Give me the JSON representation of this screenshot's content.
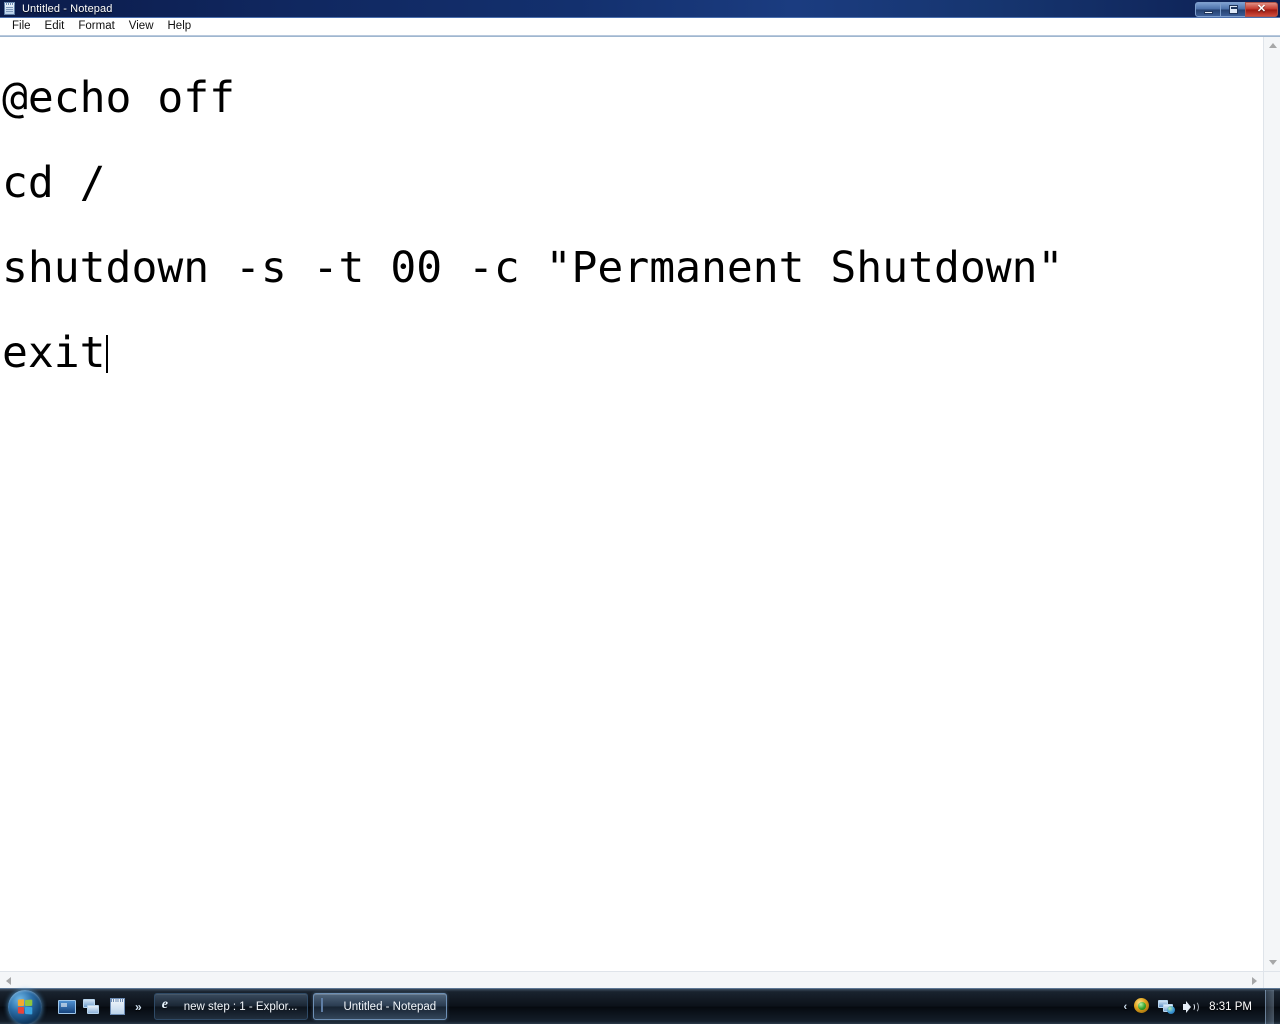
{
  "window": {
    "title": "Untitled - Notepad",
    "icon": "notepad-icon",
    "controls": {
      "minimize": "–",
      "maximize": "❐",
      "close": "✕"
    }
  },
  "menubar": {
    "items": [
      {
        "label": "File"
      },
      {
        "label": "Edit"
      },
      {
        "label": "Format"
      },
      {
        "label": "View"
      },
      {
        "label": "Help"
      }
    ]
  },
  "editor": {
    "lines": [
      "@echo off",
      "cd /",
      "shutdown -s -t 00 -c \"Permanent Shutdown\"",
      "exit"
    ],
    "caret_line": 3,
    "text_color": "#000000",
    "background": "#ffffff",
    "wordwrap": false
  },
  "scrollbars": {
    "vertical": {
      "up": "▲",
      "down": "▼"
    },
    "horizontal": {
      "left": "◀",
      "right": "▶"
    }
  },
  "taskbar": {
    "start": {
      "label": "Start",
      "icon": "windows-orb-icon"
    },
    "quicklaunch": {
      "items": [
        {
          "icon": "show-desktop-icon",
          "label": "Show desktop"
        },
        {
          "icon": "switch-windows-icon",
          "label": "Switch between windows"
        },
        {
          "icon": "notepad-icon",
          "label": "Notepad"
        }
      ],
      "overflow": "»"
    },
    "tasks": [
      {
        "label": "new step : 1 - Explor...",
        "icon": "internet-explorer-icon",
        "active": false
      },
      {
        "label": "Untitled - Notepad",
        "icon": "notepad-icon",
        "active": true
      }
    ],
    "tray": {
      "expand": "‹",
      "icons": [
        {
          "icon": "antivirus-shield-icon",
          "label": "Security status"
        },
        {
          "icon": "network-icon",
          "label": "Network"
        },
        {
          "icon": "volume-icon",
          "label": "Volume"
        }
      ],
      "clock": "8:31 PM"
    }
  },
  "colors": {
    "titlebar_start": "#0b1b4a",
    "titlebar_end": "#1b3c80",
    "close_button": "#c4352a",
    "taskbar": "#0c121a",
    "editor_bg": "#ffffff",
    "editor_fg": "#000000"
  }
}
